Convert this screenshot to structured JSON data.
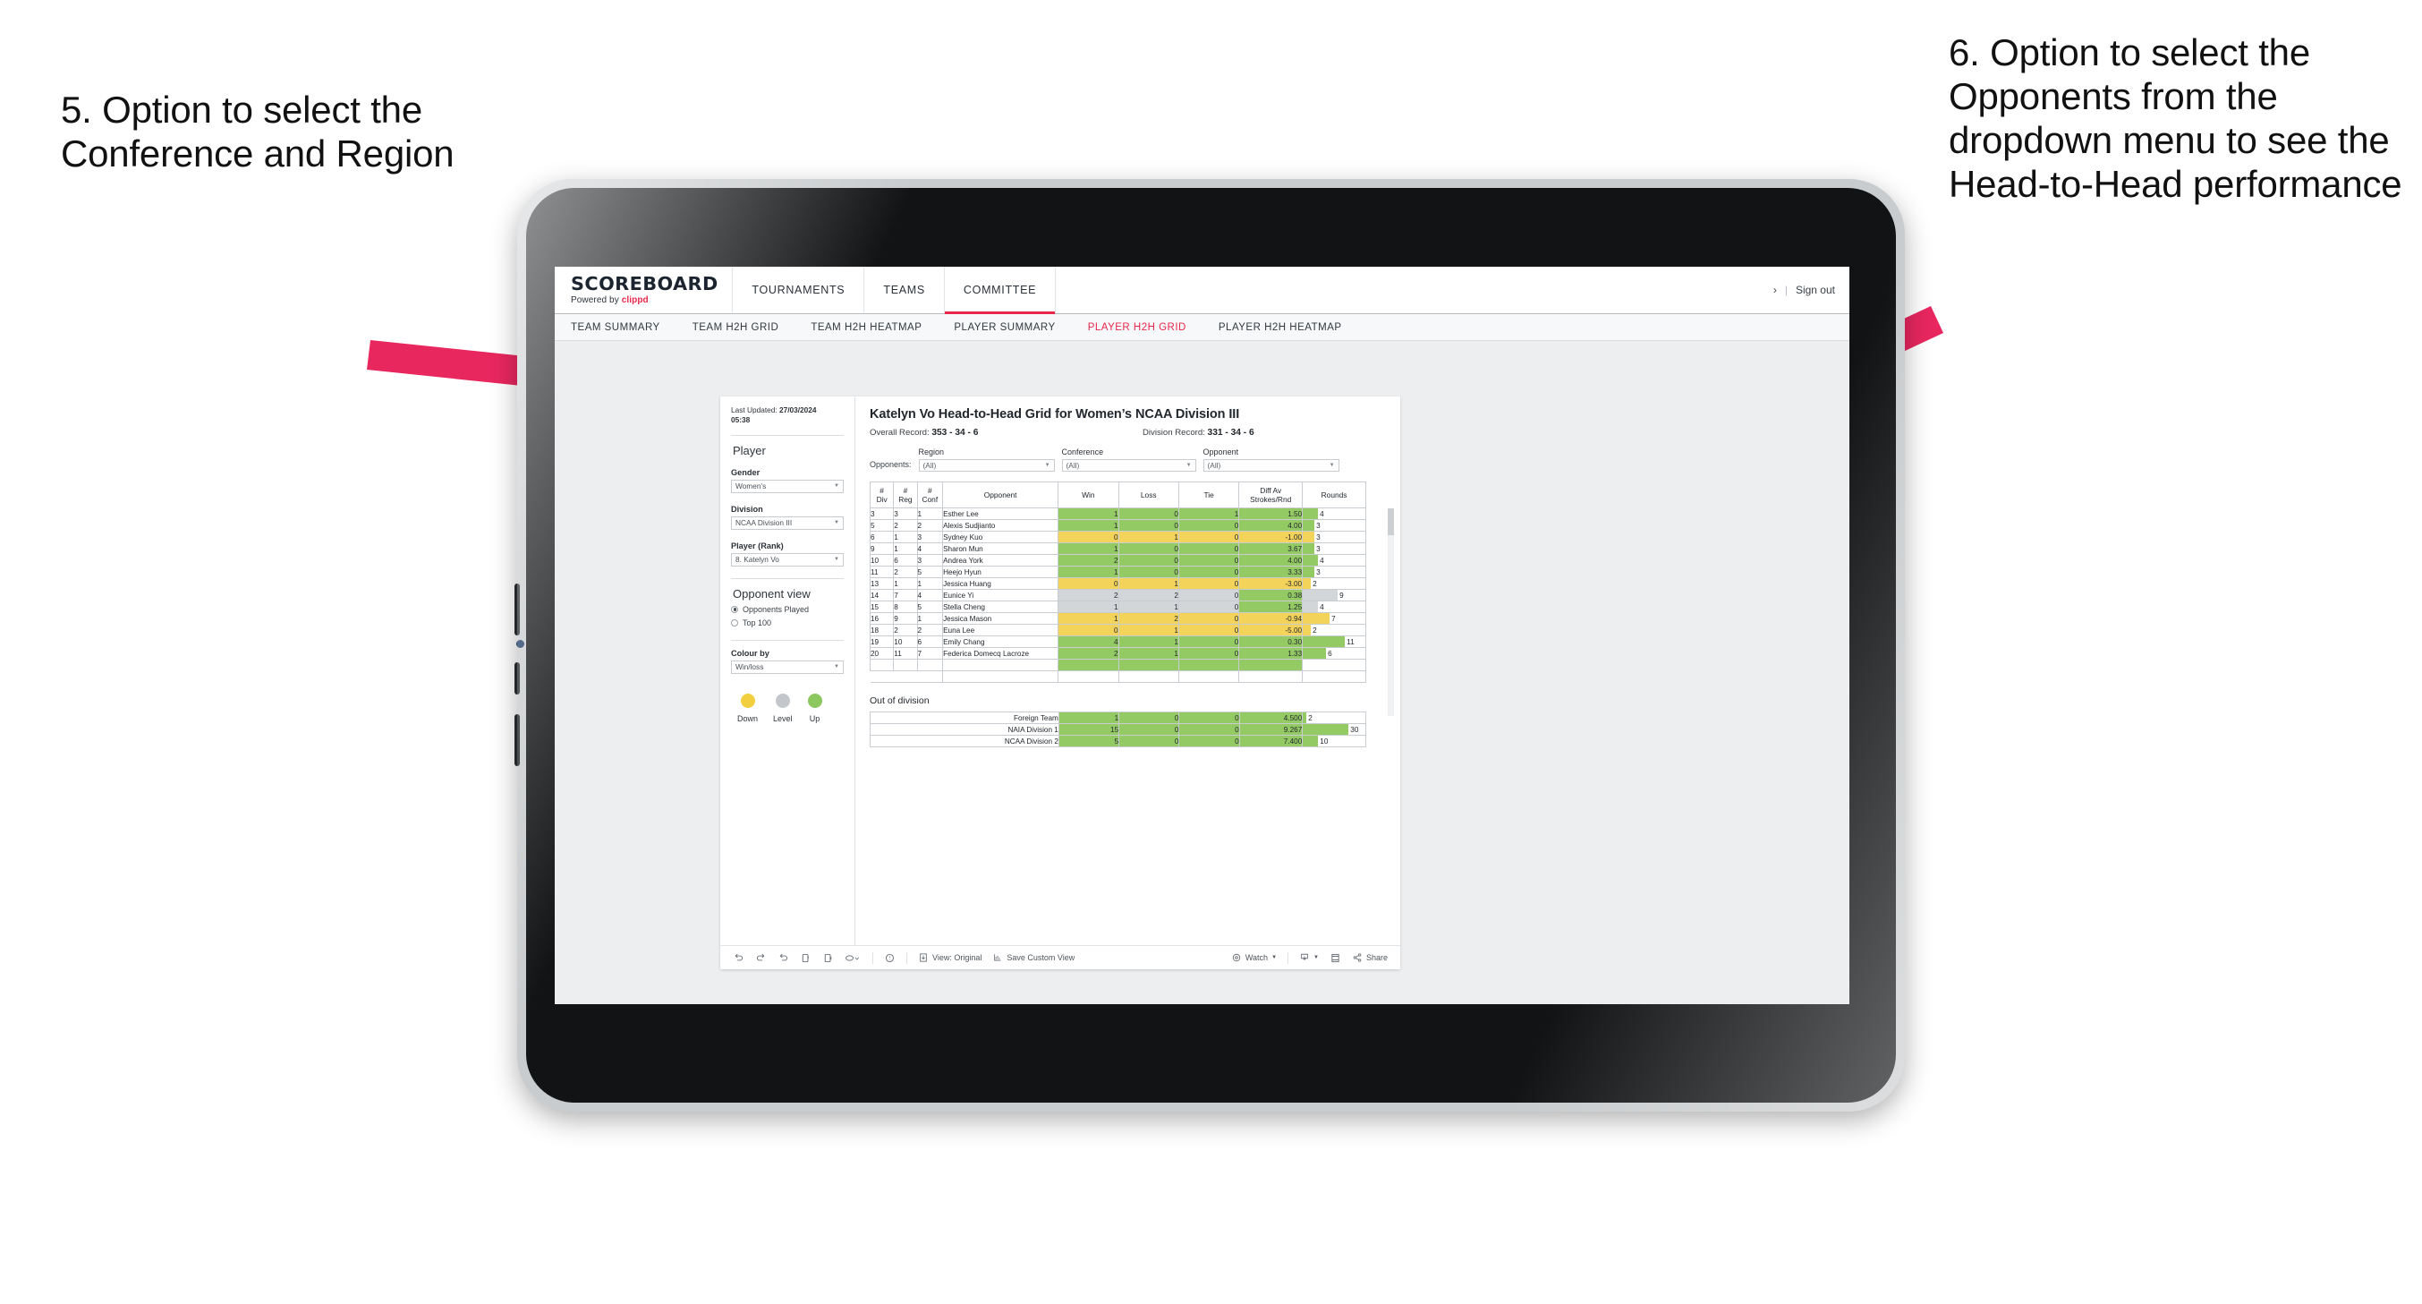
{
  "annotations": {
    "left": "5. Option to select the Conference and Region",
    "right": "6. Option to select the Opponents from the dropdown menu to see the Head-to-Head performance"
  },
  "app": {
    "brand": {
      "word": "SCOREBOARD",
      "powered_prefix": "Powered by ",
      "powered_brand": "clippd"
    },
    "main_nav": [
      {
        "label": "TOURNAMENTS",
        "active": false
      },
      {
        "label": "TEAMS",
        "active": false
      },
      {
        "label": "COMMITTEE",
        "active": true
      }
    ],
    "header_right": {
      "chevron": "›",
      "separator": "|",
      "sign_out": "Sign out"
    },
    "sub_nav": [
      {
        "label": "TEAM SUMMARY",
        "active": false
      },
      {
        "label": "TEAM H2H GRID",
        "active": false
      },
      {
        "label": "TEAM H2H HEATMAP",
        "active": false
      },
      {
        "label": "PLAYER SUMMARY",
        "active": false
      },
      {
        "label": "PLAYER H2H GRID",
        "active": true
      },
      {
        "label": "PLAYER H2H HEATMAP",
        "active": false
      }
    ]
  },
  "sidebar": {
    "last_updated_label": "Last Updated:",
    "last_updated_value": "27/03/2024",
    "last_updated_time": "05:38",
    "player_heading": "Player",
    "gender": {
      "label": "Gender",
      "value": "Women’s"
    },
    "division": {
      "label": "Division",
      "value": "NCAA Division III"
    },
    "player_rank": {
      "label": "Player (Rank)",
      "value": "8. Katelyn Vo"
    },
    "opponent_view": {
      "heading": "Opponent view",
      "options": [
        {
          "label": "Opponents Played",
          "selected": true
        },
        {
          "label": "Top 100",
          "selected": false
        }
      ]
    },
    "colour_by": {
      "label": "Colour by",
      "value": "Win/loss"
    },
    "legend": [
      {
        "label": "Down",
        "color": "#f2cf3f"
      },
      {
        "label": "Level",
        "color": "#c3c7cb"
      },
      {
        "label": "Up",
        "color": "#8dc760"
      }
    ]
  },
  "viz": {
    "title": "Katelyn Vo Head-to-Head Grid for Women’s NCAA Division III",
    "overall_record_label": "Overall Record:",
    "overall_record_value": "353 - 34 - 6",
    "division_record_label": "Division Record:",
    "division_record_value": "331 - 34 - 6",
    "opponents_label": "Opponents:",
    "filters": [
      {
        "label": "Region",
        "value": "(All)"
      },
      {
        "label": "Conference",
        "value": "(All)"
      },
      {
        "label": "Opponent",
        "value": "(All)"
      }
    ],
    "out_of_division_title": "Out of division"
  },
  "toolbar": {
    "view_label": "View: Original",
    "save_label": "Save Custom View",
    "watch_label": "Watch",
    "share_label": "Share"
  },
  "chart_data": {
    "type": "table",
    "title": "Katelyn Vo Head-to-Head Grid for Women’s NCAA Division III",
    "columns": [
      "# Div",
      "# Reg",
      "# Conf",
      "Opponent",
      "Win",
      "Loss",
      "Tie",
      "Diff Av Strokes/Rnd",
      "Rounds"
    ],
    "column_headers_split": [
      {
        "top": "#",
        "bottom": "Div"
      },
      {
        "top": "#",
        "bottom": "Reg"
      },
      {
        "top": "#",
        "bottom": "Conf"
      },
      {
        "top": "",
        "bottom": "Opponent"
      },
      {
        "top": "",
        "bottom": "Win"
      },
      {
        "top": "",
        "bottom": "Loss"
      },
      {
        "top": "",
        "bottom": "Tie"
      },
      {
        "top": "Diff Av",
        "bottom": "Strokes/Rnd"
      },
      {
        "top": "",
        "bottom": "Rounds"
      }
    ],
    "rows": [
      {
        "div": "3",
        "reg": "3",
        "conf": "1",
        "opponent": "Esther Lee",
        "win": "1",
        "loss": "0",
        "tie": "1",
        "diff": "1.50",
        "rounds": "4",
        "state": "up"
      },
      {
        "div": "5",
        "reg": "2",
        "conf": "2",
        "opponent": "Alexis Sudjianto",
        "win": "1",
        "loss": "0",
        "tie": "0",
        "diff": "4.00",
        "rounds": "3",
        "state": "up"
      },
      {
        "div": "6",
        "reg": "1",
        "conf": "3",
        "opponent": "Sydney Kuo",
        "win": "0",
        "loss": "1",
        "tie": "0",
        "diff": "-1.00",
        "rounds": "3",
        "state": "down"
      },
      {
        "div": "9",
        "reg": "1",
        "conf": "4",
        "opponent": "Sharon Mun",
        "win": "1",
        "loss": "0",
        "tie": "0",
        "diff": "3.67",
        "rounds": "3",
        "state": "up"
      },
      {
        "div": "10",
        "reg": "6",
        "conf": "3",
        "opponent": "Andrea York",
        "win": "2",
        "loss": "0",
        "tie": "0",
        "diff": "4.00",
        "rounds": "4",
        "state": "up"
      },
      {
        "div": "11",
        "reg": "2",
        "conf": "5",
        "opponent": "Heejo Hyun",
        "win": "1",
        "loss": "0",
        "tie": "0",
        "diff": "3.33",
        "rounds": "3",
        "state": "up"
      },
      {
        "div": "13",
        "reg": "1",
        "conf": "1",
        "opponent": "Jessica Huang",
        "win": "0",
        "loss": "1",
        "tie": "0",
        "diff": "-3.00",
        "rounds": "2",
        "state": "down"
      },
      {
        "div": "14",
        "reg": "7",
        "conf": "4",
        "opponent": "Eunice Yi",
        "win": "2",
        "loss": "2",
        "tie": "0",
        "diff": "0.38",
        "rounds": "9",
        "state": "level",
        "diff_state": "up"
      },
      {
        "div": "15",
        "reg": "8",
        "conf": "5",
        "opponent": "Stella Cheng",
        "win": "1",
        "loss": "1",
        "tie": "0",
        "diff": "1.25",
        "rounds": "4",
        "state": "level",
        "diff_state": "up"
      },
      {
        "div": "16",
        "reg": "9",
        "conf": "1",
        "opponent": "Jessica Mason",
        "win": "1",
        "loss": "2",
        "tie": "0",
        "diff": "-0.94",
        "rounds": "7",
        "state": "down"
      },
      {
        "div": "18",
        "reg": "2",
        "conf": "2",
        "opponent": "Euna Lee",
        "win": "0",
        "loss": "1",
        "tie": "0",
        "diff": "-5.00",
        "rounds": "2",
        "state": "down"
      },
      {
        "div": "19",
        "reg": "10",
        "conf": "6",
        "opponent": "Emily Chang",
        "win": "4",
        "loss": "1",
        "tie": "0",
        "diff": "0.30",
        "rounds": "11",
        "state": "up"
      },
      {
        "div": "20",
        "reg": "11",
        "conf": "7",
        "opponent": "Federica Domecq Lacroze",
        "win": "2",
        "loss": "1",
        "tie": "0",
        "diff": "1.33",
        "rounds": "6",
        "state": "up"
      }
    ],
    "rounds_max": 13,
    "out_of_division": [
      {
        "name": "Foreign Team",
        "win": "1",
        "loss": "0",
        "tie": "0",
        "diff": "4.500",
        "rounds": "2",
        "state": "up"
      },
      {
        "name": "NAIA Division 1",
        "win": "15",
        "loss": "0",
        "tie": "0",
        "diff": "9.267",
        "rounds": "30",
        "state": "up"
      },
      {
        "name": "NCAA Division 2",
        "win": "5",
        "loss": "0",
        "tie": "0",
        "diff": "7.400",
        "rounds": "10",
        "state": "up"
      }
    ],
    "ood_rounds_max": 33
  }
}
